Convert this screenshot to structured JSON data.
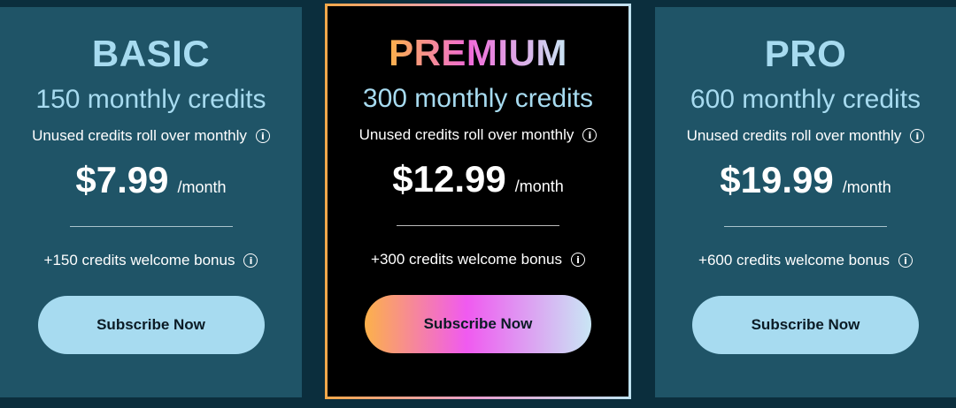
{
  "plans": [
    {
      "tier": "BASIC",
      "credits": "150 monthly credits",
      "rollover": "Unused credits roll over monthly",
      "price": "$7.99",
      "period": "/month",
      "bonus": "+150 credits welcome bonus",
      "button": "Subscribe Now"
    },
    {
      "tier": "PREMIUM",
      "credits": "300 monthly credits",
      "rollover": "Unused credits roll over monthly",
      "price": "$12.99",
      "period": "/month",
      "bonus": "+300 credits welcome bonus",
      "button": "Subscribe Now"
    },
    {
      "tier": "PRO",
      "credits": "600 monthly credits",
      "rollover": "Unused credits roll over monthly",
      "price": "$19.99",
      "period": "/month",
      "bonus": "+600 credits welcome bonus",
      "button": "Subscribe Now"
    }
  ],
  "icons": {
    "info": "info-circle-icon"
  },
  "colors": {
    "page_background": "#0b2e3d",
    "card_background": "#1f5467",
    "premium_background": "#000000",
    "accent_light_blue": "#a7dbf0",
    "gradient_orange": "#fcb14a",
    "gradient_pink": "#f05af0",
    "gradient_blue": "#c9e6f4"
  }
}
